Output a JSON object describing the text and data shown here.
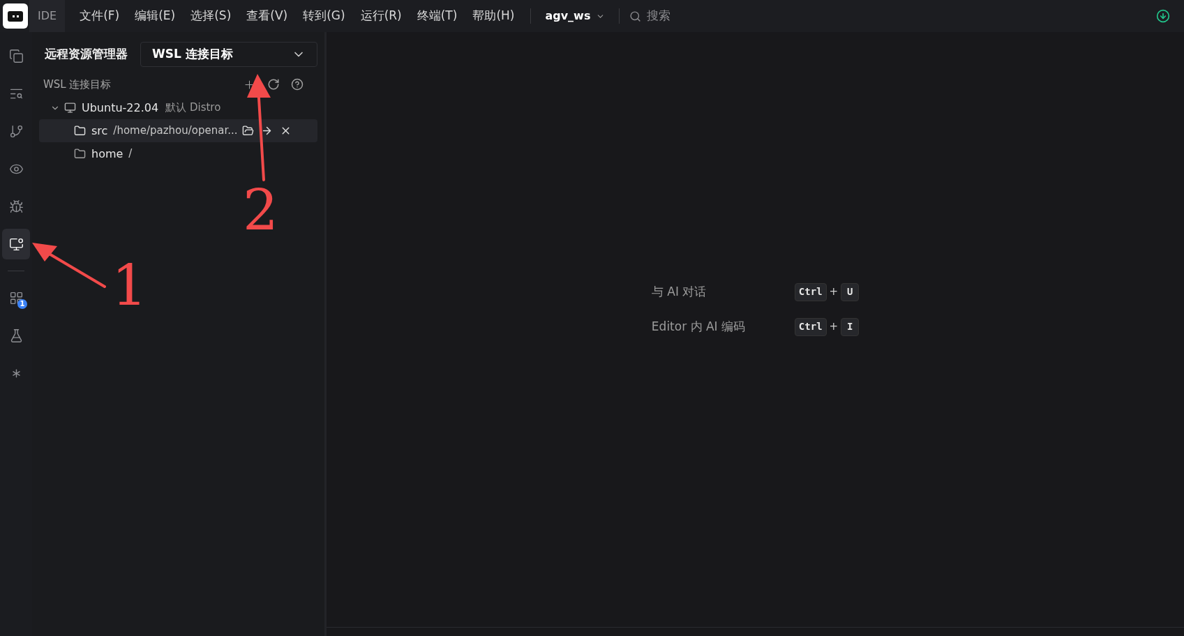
{
  "titlebar": {
    "app_label": "IDE",
    "menu": [
      "文件(F)",
      "编辑(E)",
      "选择(S)",
      "查看(V)",
      "转到(G)",
      "运行(R)",
      "终端(T)",
      "帮助(H)"
    ],
    "workspace": "agv_ws",
    "search": {
      "placeholder": "搜索"
    }
  },
  "activity_bar": [
    {
      "kind": "files",
      "selected": false
    },
    {
      "kind": "search",
      "selected": false
    },
    {
      "kind": "branch",
      "selected": false
    },
    {
      "kind": "eye",
      "selected": false
    },
    {
      "kind": "bug",
      "selected": false
    },
    {
      "kind": "remote",
      "selected": true
    },
    {
      "kind": "divider"
    },
    {
      "kind": "extensions",
      "selected": false,
      "badge": "1"
    },
    {
      "kind": "flask",
      "selected": false
    },
    {
      "kind": "spark",
      "selected": false
    }
  ],
  "sidebar": {
    "title": "远程资源管理器",
    "dropdown": "WSL 连接目标",
    "section": "WSL 连接目标",
    "tree": [
      {
        "label": "Ubuntu-22.04",
        "note": "默认 Distro",
        "expanded": true,
        "children": [
          {
            "label": "src",
            "path": "/home/pazhou/openar...",
            "selected": true
          },
          {
            "label": "home",
            "path": "/",
            "selected": false
          }
        ]
      }
    ]
  },
  "editor": {
    "hints": [
      {
        "label": "与 AI 对话",
        "keys": [
          "Ctrl",
          "U"
        ],
        "joiner": "+"
      },
      {
        "label": "Editor 内 AI 编码",
        "keys": [
          "Ctrl",
          "I"
        ],
        "joiner": "+"
      }
    ]
  },
  "annotations": [
    {
      "number": "1"
    },
    {
      "number": "2"
    }
  ]
}
